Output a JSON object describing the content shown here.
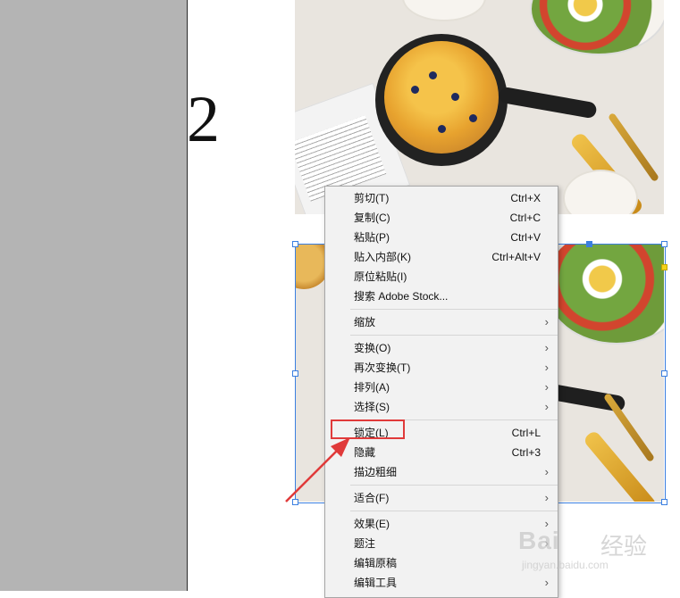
{
  "page": {
    "page_number": "2"
  },
  "menu": {
    "items": [
      {
        "label": "剪切(T)",
        "shortcut": "Ctrl+X"
      },
      {
        "label": "复制(C)",
        "shortcut": "Ctrl+C"
      },
      {
        "label": "粘贴(P)",
        "shortcut": "Ctrl+V"
      },
      {
        "label": "贴入内部(K)",
        "shortcut": "Ctrl+Alt+V"
      },
      {
        "label": "原位粘贴(I)",
        "shortcut": ""
      },
      {
        "label": "搜索 Adobe Stock...",
        "shortcut": ""
      },
      {
        "label": "缩放",
        "shortcut": "",
        "submenu": true
      },
      {
        "label": "变换(O)",
        "shortcut": "",
        "submenu": true
      },
      {
        "label": "再次变换(T)",
        "shortcut": "",
        "submenu": true
      },
      {
        "label": "排列(A)",
        "shortcut": "",
        "submenu": true
      },
      {
        "label": "选择(S)",
        "shortcut": "",
        "submenu": true
      },
      {
        "label": "锁定(L)",
        "shortcut": "Ctrl+L"
      },
      {
        "label": "隐藏",
        "shortcut": "Ctrl+3"
      },
      {
        "label": "描边粗细",
        "shortcut": "",
        "submenu": true
      },
      {
        "label": "适合(F)",
        "shortcut": "",
        "submenu": true
      },
      {
        "label": "效果(E)",
        "shortcut": "",
        "submenu": true
      },
      {
        "label": "题注",
        "shortcut": "",
        "submenu": true
      },
      {
        "label": "编辑原稿",
        "shortcut": ""
      },
      {
        "label": "编辑工具",
        "shortcut": "",
        "submenu": true
      }
    ],
    "submenu_arrow": "›",
    "highlighted_item": "锁定(L)"
  },
  "watermark": {
    "brand": "Bai",
    "cn": "经验",
    "url": "jingyan.baidu.com"
  },
  "colors": {
    "selection": "#3b7fe0",
    "highlight": "#e03a3a",
    "pasteboard": "#b4b4b4"
  }
}
